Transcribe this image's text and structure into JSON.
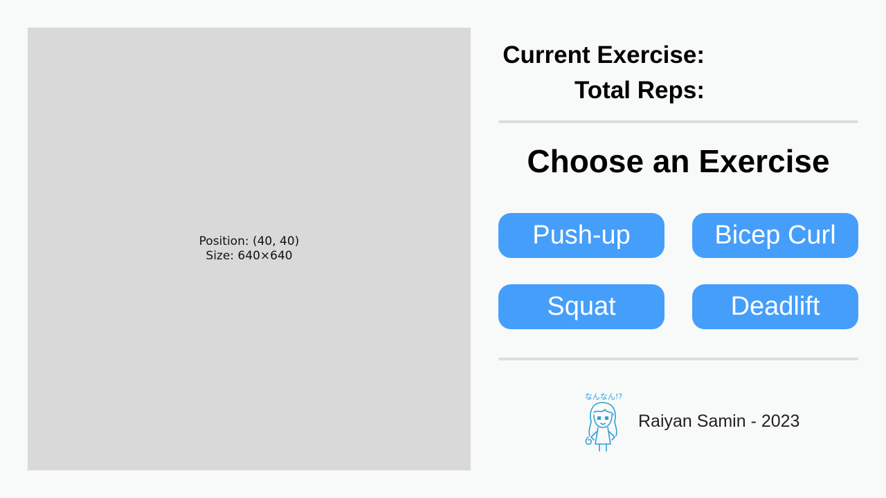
{
  "video_panel": {
    "position_label": "Position: (40, 40)",
    "size_label": "Size: 640×640"
  },
  "status": {
    "current_exercise_label": "Current Exercise:",
    "total_reps_label": "Total Reps:"
  },
  "chooser": {
    "heading": "Choose an Exercise",
    "buttons": [
      "Push-up",
      "Bicep Curl",
      "Squat",
      "Deadlift"
    ]
  },
  "footer": {
    "avatar_caption": "なんなん!?",
    "credit": "Raiyan Samin - 2023"
  },
  "colors": {
    "background": "#f8f9f9",
    "panel": "#d9d9d9",
    "button": "#459efa",
    "divider": "#dcdcdc",
    "sketch": "#2f9fd4"
  }
}
